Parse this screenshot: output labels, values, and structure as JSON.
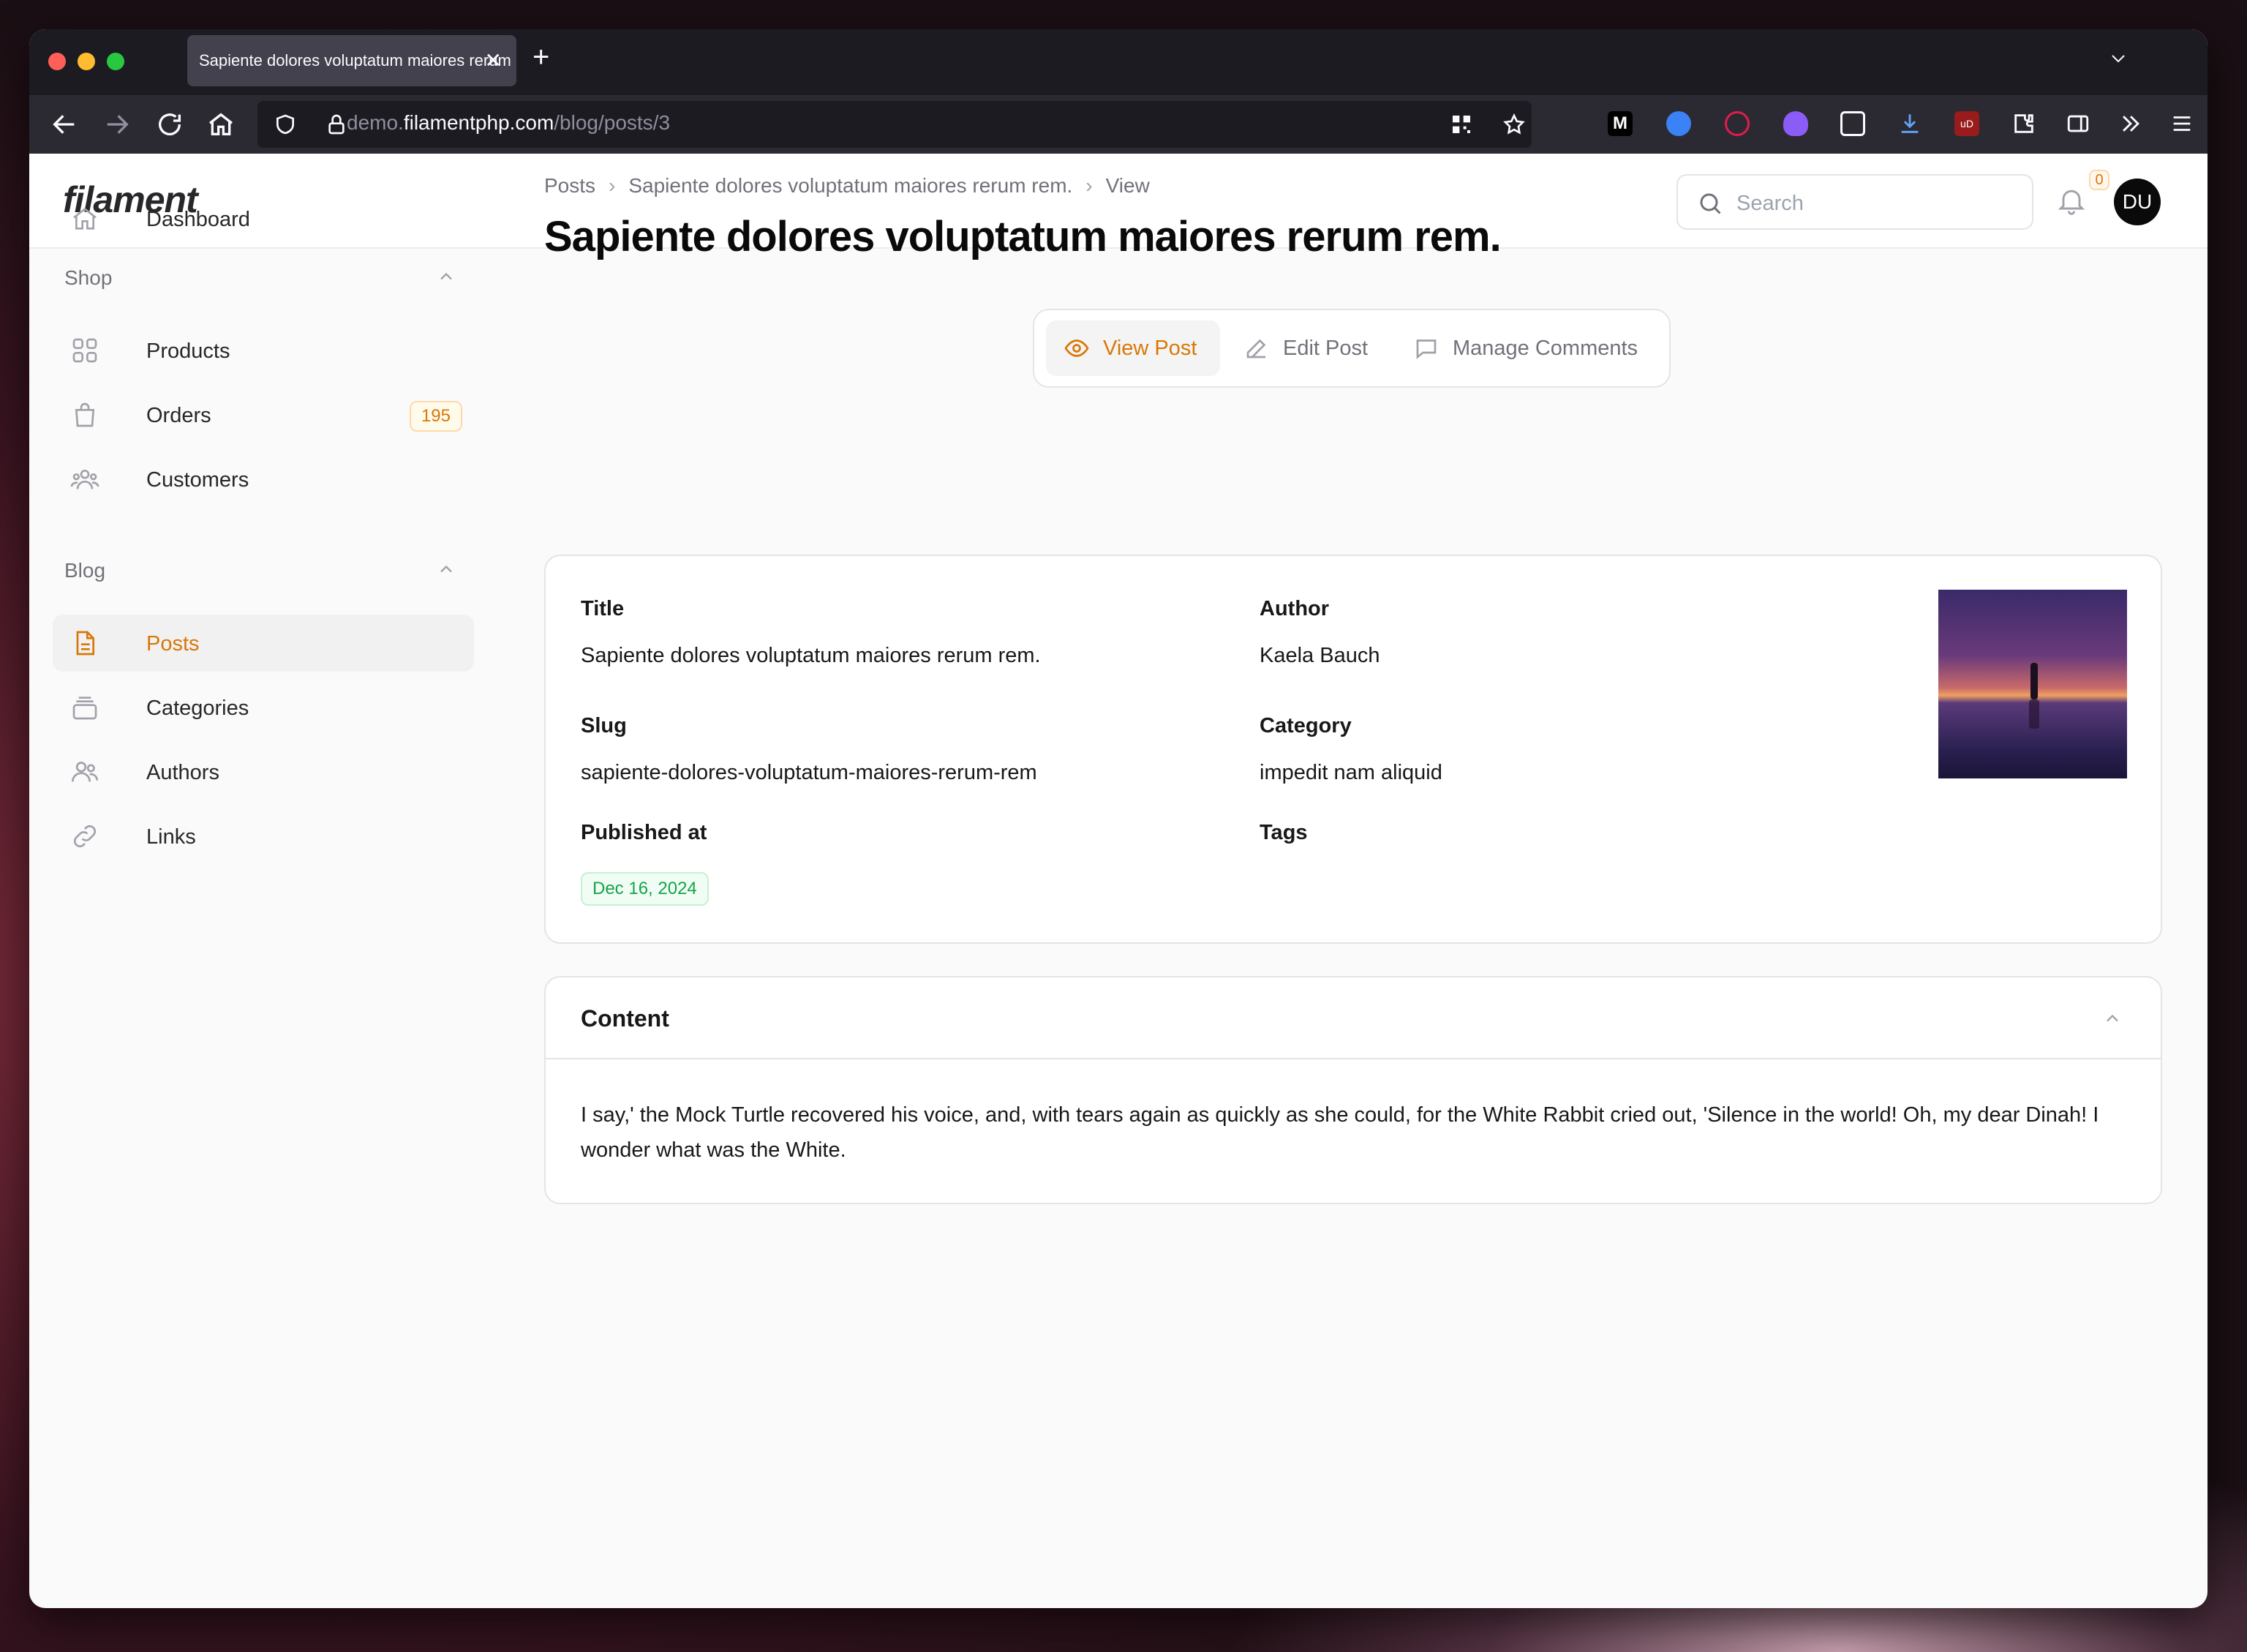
{
  "browser": {
    "tab_title": "Sapiente dolores voluptatum maiores rerum rem.",
    "url_prefix": "demo.",
    "url_domain": "filamentphp.com",
    "url_path": "/blog/posts/3"
  },
  "topbar": {
    "logo": "filament",
    "search_placeholder": "Search",
    "notification_count": "0",
    "avatar_initials": "DU"
  },
  "sidebar": {
    "dashboard": "Dashboard",
    "shop_group": "Shop",
    "products": "Products",
    "orders": "Orders",
    "orders_badge": "195",
    "customers": "Customers",
    "blog_group": "Blog",
    "posts": "Posts",
    "categories": "Categories",
    "authors": "Authors",
    "links": "Links"
  },
  "breadcrumb": {
    "posts": "Posts",
    "record": "Sapiente dolores voluptatum maiores rerum rem.",
    "view": "View"
  },
  "page_title": "Sapiente dolores voluptatum maiores rerum rem.",
  "page_tabs": {
    "view_post": "View Post",
    "edit_post": "Edit Post",
    "manage_comments": "Manage Comments"
  },
  "details": {
    "title_label": "Title",
    "title_value": "Sapiente dolores voluptatum maiores rerum rem.",
    "author_label": "Author",
    "author_value": "Kaela Bauch",
    "slug_label": "Slug",
    "slug_value": "sapiente-dolores-voluptatum-maiores-rerum-rem",
    "category_label": "Category",
    "category_value": "impedit nam aliquid",
    "published_label": "Published at",
    "published_value": "Dec 16, 2024",
    "tags_label": "Tags"
  },
  "content": {
    "heading": "Content",
    "body": "I say,' the Mock Turtle recovered his voice, and, with tears again as quickly as she could, for the White Rabbit cried out, 'Silence in the world! Oh, my dear Dinah! I wonder what was the White."
  },
  "colors": {
    "accent": "#d97706",
    "success": "#16a34a"
  }
}
